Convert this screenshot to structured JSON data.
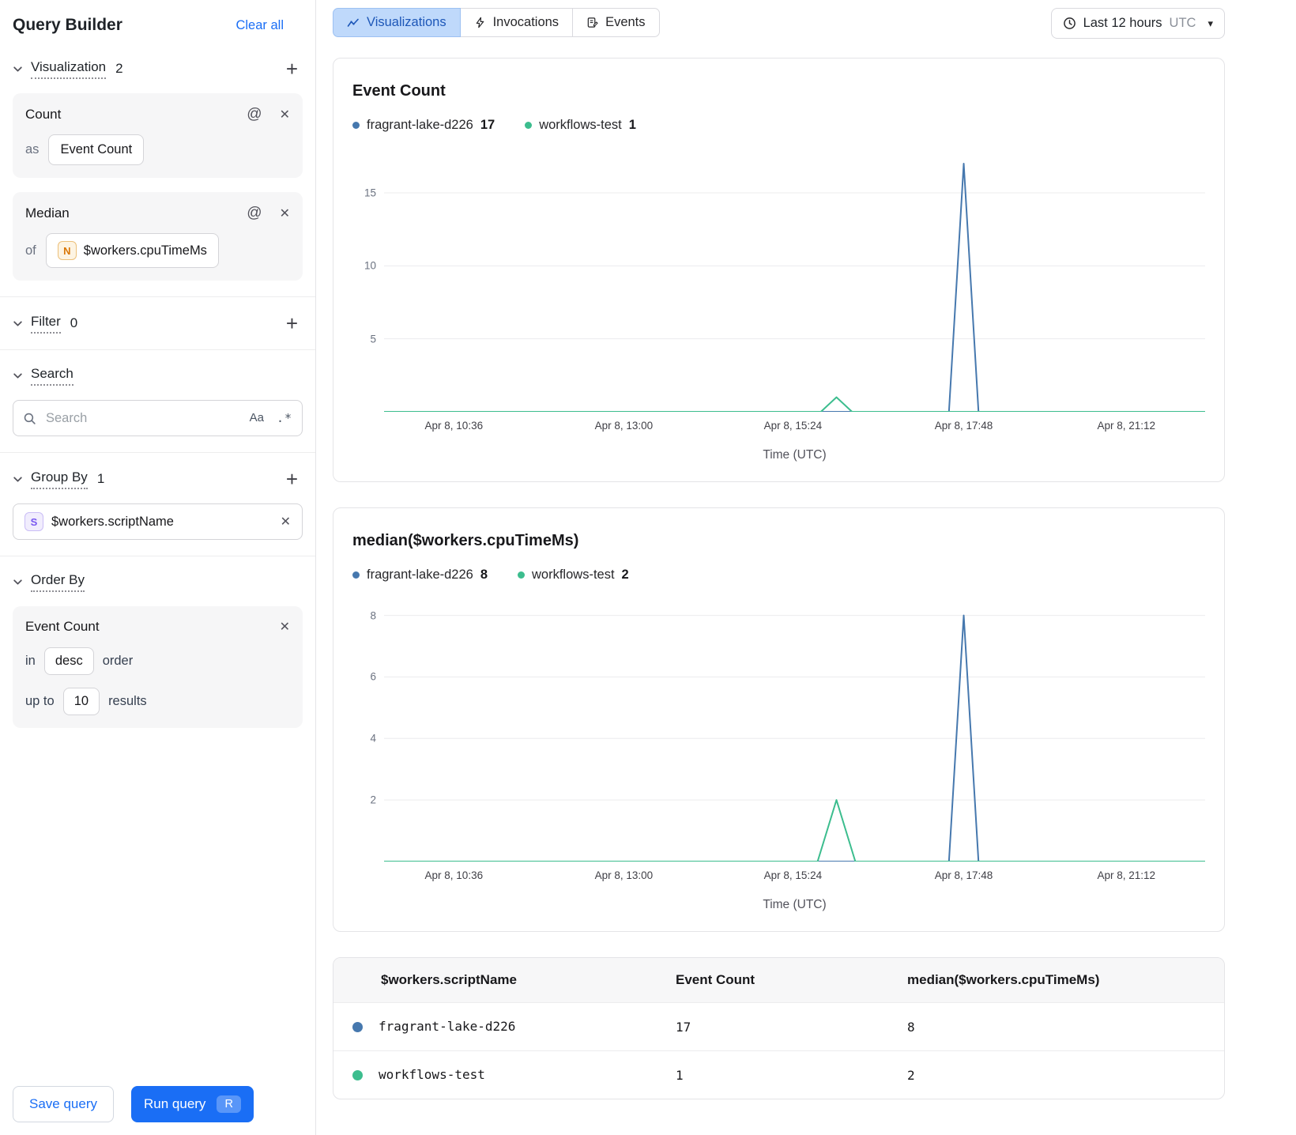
{
  "icons": {
    "plus": "+",
    "close": "✕",
    "at": "@",
    "caret_down": "▾",
    "match_case": "Aa",
    "regex": ".*"
  },
  "sidebar": {
    "title": "Query Builder",
    "clear_all": "Clear all",
    "visualization": {
      "label": "Visualization",
      "count": "2",
      "cards": [
        {
          "title": "Count",
          "prefix": "as",
          "chip": "Event Count"
        },
        {
          "title": "Median",
          "prefix": "of",
          "chip_icon": "N",
          "chip": "$workers.cpuTimeMs"
        }
      ]
    },
    "filter": {
      "label": "Filter",
      "count": "0"
    },
    "search": {
      "label": "Search",
      "placeholder": "Search"
    },
    "group_by": {
      "label": "Group By",
      "count": "1",
      "chip_icon": "S",
      "chip": "$workers.scriptName"
    },
    "order_by": {
      "label": "Order By",
      "field": "Event Count",
      "in_label": "in",
      "order_value": "desc",
      "order_suffix": "order",
      "upto_label": "up to",
      "limit_value": "10",
      "results_suffix": "results"
    },
    "save_button": "Save query",
    "run_button": "Run query",
    "run_shortcut": "R"
  },
  "topbar": {
    "tabs": [
      {
        "label": "Visualizations",
        "icon": "chart-line",
        "active": true
      },
      {
        "label": "Invocations",
        "icon": "bolt",
        "active": false
      },
      {
        "label": "Events",
        "icon": "note",
        "active": false
      }
    ],
    "time_range": {
      "label": "Last 12 hours",
      "zone": "UTC"
    }
  },
  "colors": {
    "accent_blue": "#1a6ef5",
    "series_blue": "#4678ae",
    "series_green": "#3cbd8e",
    "tab_active_bg": "#bfd9fb"
  },
  "chart_data": [
    {
      "type": "line",
      "title": "Event Count",
      "xlabel": "Time (UTC)",
      "ylim": [
        0,
        17.6
      ],
      "y_ticks": [
        5,
        10,
        15
      ],
      "x_ticks": [
        "Apr 8, 10:36",
        "Apr 8, 13:00",
        "Apr 8, 15:24",
        "Apr 8, 17:48",
        "Apr 8, 21:12"
      ],
      "x_tick_fractions": [
        0.085,
        0.292,
        0.498,
        0.706,
        0.904
      ],
      "grid": true,
      "legend_position": "top",
      "legend": [
        {
          "label": "fragrant-lake-d226",
          "value": "17",
          "color": "#4678ae"
        },
        {
          "label": "workflows-test",
          "value": "1",
          "color": "#3cbd8e"
        }
      ],
      "series": [
        {
          "name": "fragrant-lake-d226",
          "color": "#4678ae",
          "points": [
            [
              0,
              0
            ],
            [
              0.688,
              0
            ],
            [
              0.706,
              17
            ],
            [
              0.724,
              0
            ],
            [
              1,
              0
            ]
          ]
        },
        {
          "name": "workflows-test",
          "color": "#3cbd8e",
          "points": [
            [
              0,
              0
            ],
            [
              0.532,
              0
            ],
            [
              0.551,
              1
            ],
            [
              0.57,
              0
            ],
            [
              1,
              0
            ]
          ]
        }
      ]
    },
    {
      "type": "line",
      "title": "median($workers.cpuTimeMs)",
      "xlabel": "Time (UTC)",
      "ylim": [
        0,
        8.35
      ],
      "y_ticks": [
        2,
        4,
        6,
        8
      ],
      "x_ticks": [
        "Apr 8, 10:36",
        "Apr 8, 13:00",
        "Apr 8, 15:24",
        "Apr 8, 17:48",
        "Apr 8, 21:12"
      ],
      "x_tick_fractions": [
        0.085,
        0.292,
        0.498,
        0.706,
        0.904
      ],
      "grid": true,
      "legend_position": "top",
      "legend": [
        {
          "label": "fragrant-lake-d226",
          "value": "8",
          "color": "#4678ae"
        },
        {
          "label": "workflows-test",
          "value": "2",
          "color": "#3cbd8e"
        }
      ],
      "series": [
        {
          "name": "fragrant-lake-d226",
          "color": "#4678ae",
          "points": [
            [
              0,
              0
            ],
            [
              0.688,
              0
            ],
            [
              0.706,
              8
            ],
            [
              0.724,
              0
            ],
            [
              1,
              0
            ]
          ]
        },
        {
          "name": "workflows-test",
          "color": "#3cbd8e",
          "points": [
            [
              0,
              0
            ],
            [
              0.528,
              0
            ],
            [
              0.551,
              2
            ],
            [
              0.574,
              0
            ],
            [
              1,
              0
            ]
          ]
        }
      ]
    }
  ],
  "table": {
    "columns": [
      "$workers.scriptName",
      "Event Count",
      "median($workers.cpuTimeMs)"
    ],
    "rows": [
      {
        "color": "#4678ae",
        "name": "fragrant-lake-d226",
        "values": [
          "17",
          "8"
        ]
      },
      {
        "color": "#3cbd8e",
        "name": "workflows-test",
        "values": [
          "1",
          "2"
        ]
      }
    ]
  }
}
